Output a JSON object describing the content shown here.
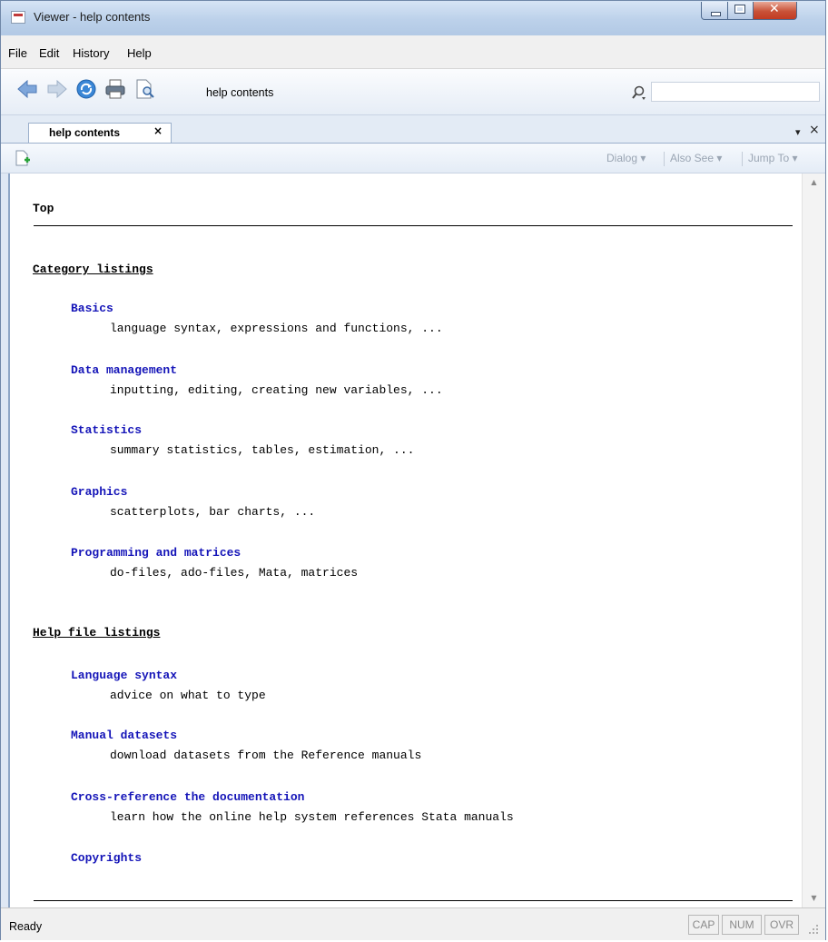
{
  "window": {
    "title": "Viewer - help contents",
    "caption_buttons": {
      "minimize": "minimize",
      "maximize": "maximize",
      "close": "close"
    }
  },
  "menu": [
    "File",
    "Edit",
    "History",
    "Help"
  ],
  "toolbar": {
    "address": "help contents",
    "search": ""
  },
  "tabs": [
    {
      "label": "help contents",
      "close": "×"
    }
  ],
  "pane_controls": {
    "menu": "▾",
    "close": "×"
  },
  "subtoolbar": {
    "dialog": "Dialog ▾",
    "also_see": "Also See ▾",
    "jump_to": "Jump To ▾"
  },
  "content": {
    "top_heading": "Top",
    "category_heading": "Category listings",
    "categories": [
      {
        "link": "Basics",
        "desc": "language syntax, expressions and functions, ..."
      },
      {
        "link": "Data management",
        "desc": "inputting, editing, creating new variables, ..."
      },
      {
        "link": "Statistics",
        "desc": "summary statistics, tables, estimation, ..."
      },
      {
        "link": "Graphics",
        "desc": "scatterplots, bar charts, ..."
      },
      {
        "link": "Programming and matrices",
        "desc": "do-files, ado-files, Mata, matrices"
      }
    ],
    "help_heading": "Help file listings",
    "help_files": [
      {
        "link": "Language syntax",
        "desc": "advice on what to type"
      },
      {
        "link": "Manual datasets",
        "desc": "download datasets from the Reference manuals"
      },
      {
        "link": "Cross-reference the documentation",
        "desc": "learn how the online help system references Stata manuals"
      },
      {
        "link": "Copyrights",
        "desc": ""
      }
    ]
  },
  "status": {
    "text": "Ready",
    "indicators": [
      "CAP",
      "NUM",
      "OVR"
    ]
  },
  "colors": {
    "link": "#1414b8",
    "title_bar": "#bcd1ea",
    "close_button": "#c95238"
  }
}
